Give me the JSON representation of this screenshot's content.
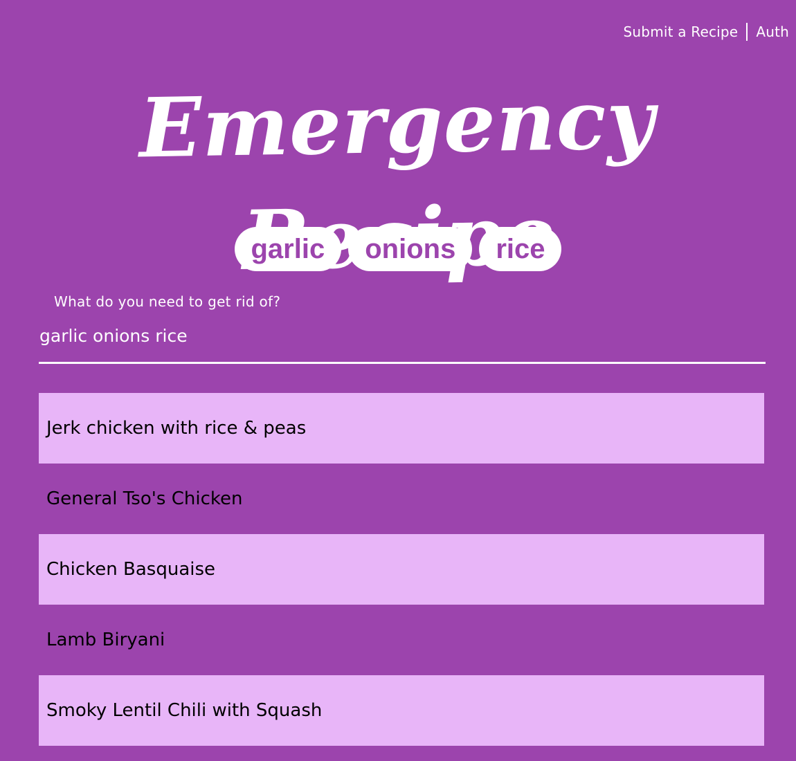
{
  "nav": {
    "submit_label": "Submit a Recipe",
    "auth_label": "Auth"
  },
  "app": {
    "title": "Emergency Recipe"
  },
  "chips": [
    "garlic",
    "onions",
    "rice"
  ],
  "search": {
    "label": "What do you need to get rid of?",
    "value": "garlic onions rice"
  },
  "results": [
    "Jerk chicken with rice & peas",
    "General Tso's Chicken",
    "Chicken Basquaise",
    "Lamb Biryani",
    "Smoky Lentil Chili with Squash"
  ],
  "colors": {
    "background": "#9c44ad",
    "row_highlight": "#e8b5f8",
    "text_light": "#ffffff"
  }
}
